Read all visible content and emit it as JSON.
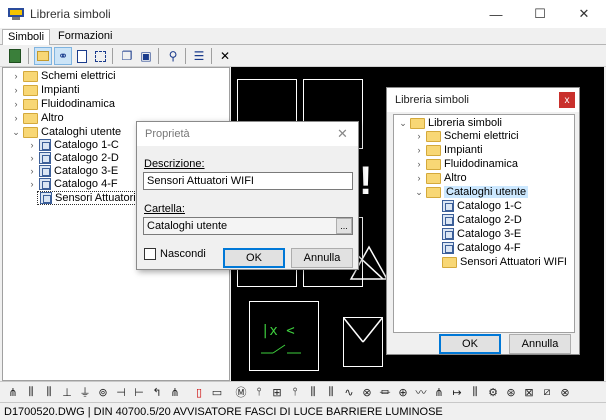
{
  "window": {
    "title": "Libreria simboli",
    "minimize": "—",
    "maximize": "☐",
    "close": "✕"
  },
  "tabs": [
    {
      "label": "Simboli"
    },
    {
      "label": "Formazioni"
    }
  ],
  "tree": {
    "items": [
      {
        "label": "Schemi elettrici"
      },
      {
        "label": "Impianti"
      },
      {
        "label": "Fluidodinamica"
      },
      {
        "label": "Altro"
      },
      {
        "label": "Cataloghi utente"
      },
      {
        "label": "Catalogo 1-C"
      },
      {
        "label": "Catalogo 2-D"
      },
      {
        "label": "Catalogo 3-E"
      },
      {
        "label": "Catalogo 4-F"
      },
      {
        "label": "Sensori Attuatori"
      }
    ]
  },
  "properties_dialog": {
    "title": "Proprietà",
    "close": "✕",
    "description_label": "Descrizione:",
    "description_value": "Sensori Attuatori WIFI",
    "folder_label": "Cartella:",
    "folder_value": "Cataloghi utente",
    "browse_label": "...",
    "hide_label": "Nascondi",
    "ok_label": "OK",
    "cancel_label": "Annulla"
  },
  "library_dialog": {
    "title": "Libreria simboli",
    "close": "x",
    "items": [
      {
        "label": "Libreria simboli"
      },
      {
        "label": "Schemi elettrici"
      },
      {
        "label": "Impianti"
      },
      {
        "label": "Fluidodinamica"
      },
      {
        "label": "Altro"
      },
      {
        "label": "Cataloghi utente"
      },
      {
        "label": "Catalogo 1-C"
      },
      {
        "label": "Catalogo 2-D"
      },
      {
        "label": "Catalogo 3-E"
      },
      {
        "label": "Catalogo 4-F"
      },
      {
        "label": "Sensori Attuatori WIFI"
      }
    ],
    "ok_label": "OK",
    "cancel_label": "Annulla"
  },
  "drawing": {
    "exclamation": "!",
    "relay_label": "|x <"
  },
  "status": {
    "text": "D1700520.DWG | DIN 40700.5/20 AVVISATORE FASCI DI LUCE BARRIERE LUMINOSE"
  }
}
